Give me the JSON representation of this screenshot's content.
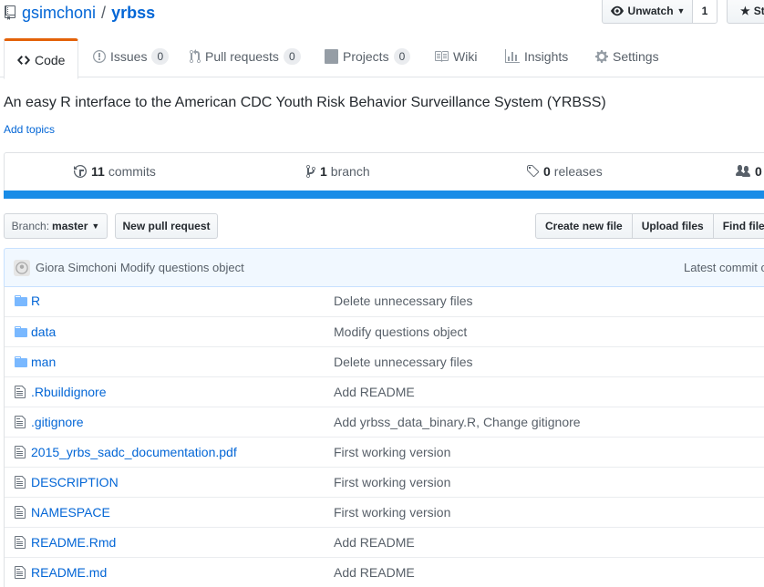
{
  "repo": {
    "owner": "gsimchoni",
    "separator": "/",
    "name": "yrbss"
  },
  "header_actions": {
    "unwatch_label": "Unwatch",
    "watch_count": "1",
    "star_label": "St"
  },
  "tabs": [
    {
      "label": "Code",
      "count": null
    },
    {
      "label": "Issues",
      "count": "0"
    },
    {
      "label": "Pull requests",
      "count": "0"
    },
    {
      "label": "Projects",
      "count": "0"
    },
    {
      "label": "Wiki",
      "count": null
    },
    {
      "label": "Insights",
      "count": null
    },
    {
      "label": "Settings",
      "count": null
    }
  ],
  "description": "An easy R interface to the American CDC Youth Risk Behavior Surveillance System (YRBSS)",
  "add_topics": "Add topics",
  "summary": {
    "commits_num": "11",
    "commits_label": "commits",
    "branch_num": "1",
    "branch_label": "branch",
    "releases_num": "0",
    "releases_label": "releases",
    "contributors_num": "0"
  },
  "language_color": "#198ce7",
  "file_nav": {
    "branch_label": "Branch:",
    "branch_value": "master",
    "new_pr": "New pull request",
    "create_file": "Create new file",
    "upload_files": "Upload files",
    "find_file": "Find file"
  },
  "latest_commit": {
    "author": "Giora Simchoni",
    "message": "Modify questions object",
    "right_text": "Latest commit c"
  },
  "files": [
    {
      "type": "dir",
      "name": "R",
      "message": "Delete unnecessary files"
    },
    {
      "type": "dir",
      "name": "data",
      "message": "Modify questions object"
    },
    {
      "type": "dir",
      "name": "man",
      "message": "Delete unnecessary files"
    },
    {
      "type": "file",
      "name": ".Rbuildignore",
      "message": "Add README"
    },
    {
      "type": "file",
      "name": ".gitignore",
      "message": "Add yrbss_data_binary.R, Change gitignore"
    },
    {
      "type": "file",
      "name": "2015_yrbs_sadc_documentation.pdf",
      "message": "First working version"
    },
    {
      "type": "file",
      "name": "DESCRIPTION",
      "message": "First working version"
    },
    {
      "type": "file",
      "name": "NAMESPACE",
      "message": "First working version"
    },
    {
      "type": "file",
      "name": "README.Rmd",
      "message": "Add README"
    },
    {
      "type": "file",
      "name": "README.md",
      "message": "Add README"
    }
  ]
}
